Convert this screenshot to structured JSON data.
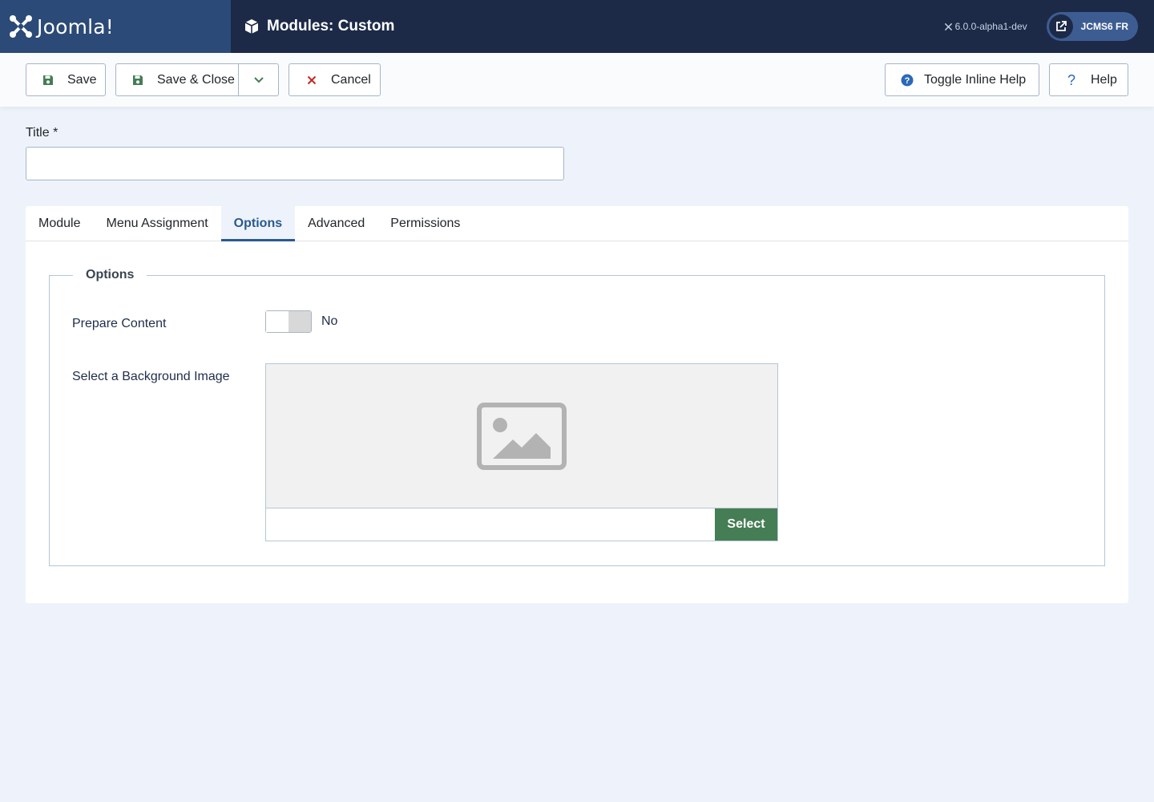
{
  "header": {
    "brand": "Joomla!",
    "title": "Modules: Custom",
    "version": "6.0.0-alpha1-dev",
    "site_button": "JCMS6 FR"
  },
  "toolbar": {
    "save_label": "Save",
    "save_close_label": "Save & Close",
    "cancel_label": "Cancel",
    "inline_help_label": "Toggle Inline Help",
    "help_label": "Help"
  },
  "form": {
    "title_label": "Title *",
    "title_value": ""
  },
  "tabs": [
    {
      "label": "Module",
      "active": false
    },
    {
      "label": "Menu Assignment",
      "active": false
    },
    {
      "label": "Options",
      "active": true
    },
    {
      "label": "Advanced",
      "active": false
    },
    {
      "label": "Permissions",
      "active": false
    }
  ],
  "options": {
    "legend": "Options",
    "prepare_content_label": "Prepare Content",
    "prepare_content_value": "No",
    "background_image_label": "Select a Background Image",
    "background_image_path": "",
    "select_label": "Select"
  },
  "colors": {
    "header_bg": "#1c2a48",
    "brand_bg": "#2b4a77",
    "accent": "#2a5a8f",
    "save_icon": "#457d54",
    "cancel_icon": "#c52827",
    "help_icon": "#2a69b8",
    "select_button": "#457d54"
  },
  "icons": {
    "brand": "joomla-logo-icon",
    "title": "cube-icon",
    "save": "floppy-disk-icon",
    "cancel": "close-icon",
    "dropdown": "chevron-down-icon",
    "inline_help": "question-circle-icon",
    "help": "question-icon",
    "site": "external-link-icon",
    "preview": "image-placeholder-icon"
  }
}
